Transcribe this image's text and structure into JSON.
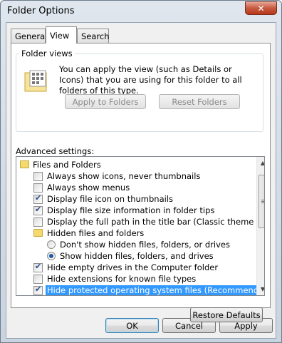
{
  "window": {
    "title": "Folder Options",
    "close_label": "✕"
  },
  "tabs": [
    {
      "label": "General",
      "active": false
    },
    {
      "label": "View",
      "active": true
    },
    {
      "label": "Search",
      "active": false
    }
  ],
  "folder_views": {
    "legend": "Folder views",
    "description": "You can apply the view (such as Details or Icons) that you are using for this folder to all folders of this type.",
    "apply_label": "Apply to Folders",
    "reset_label": "Reset Folders"
  },
  "advanced": {
    "label": "Advanced settings:",
    "items": [
      {
        "type": "folder",
        "label": "Files and Folders"
      },
      {
        "type": "checkbox",
        "label": "Always show icons, never thumbnails",
        "checked": false
      },
      {
        "type": "checkbox",
        "label": "Always show menus",
        "checked": false
      },
      {
        "type": "checkbox",
        "label": "Display file icon on thumbnails",
        "checked": true
      },
      {
        "type": "checkbox",
        "label": "Display file size information in folder tips",
        "checked": true
      },
      {
        "type": "checkbox",
        "label": "Display the full path in the title bar (Classic theme only)",
        "checked": false
      },
      {
        "type": "folder",
        "label": "Hidden files and folders"
      },
      {
        "type": "radio",
        "label": "Don't show hidden files, folders, or drives",
        "checked": false
      },
      {
        "type": "radio",
        "label": "Show hidden files, folders, and drives",
        "checked": true
      },
      {
        "type": "checkbox",
        "label": "Hide empty drives in the Computer folder",
        "checked": true
      },
      {
        "type": "checkbox",
        "label": "Hide extensions for known file types",
        "checked": false
      },
      {
        "type": "checkbox",
        "label": "Hide protected operating system files (Recommended)",
        "checked": true,
        "selected": true
      }
    ]
  },
  "restore_label": "Restore Defaults",
  "footer": {
    "ok_label": "OK",
    "cancel_label": "Cancel",
    "apply_label": "Apply"
  },
  "colors": {
    "selection": "#3399ff",
    "close_button": "#c65a3f"
  }
}
